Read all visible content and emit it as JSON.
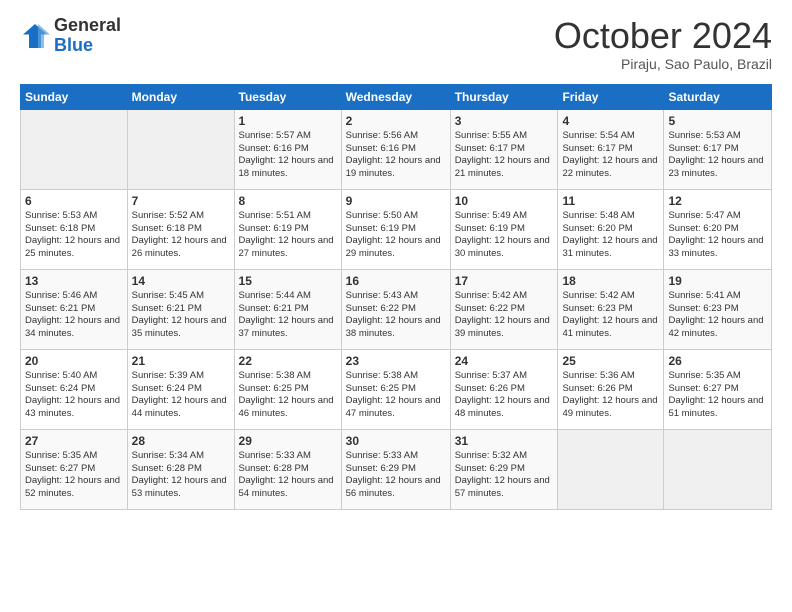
{
  "logo": {
    "general": "General",
    "blue": "Blue"
  },
  "title": "October 2024",
  "subtitle": "Piraju, Sao Paulo, Brazil",
  "weekdays": [
    "Sunday",
    "Monday",
    "Tuesday",
    "Wednesday",
    "Thursday",
    "Friday",
    "Saturday"
  ],
  "weeks": [
    [
      {
        "day": "",
        "empty": true
      },
      {
        "day": "",
        "empty": true
      },
      {
        "day": "1",
        "sunrise": "Sunrise: 5:57 AM",
        "sunset": "Sunset: 6:16 PM",
        "daylight": "Daylight: 12 hours and 18 minutes."
      },
      {
        "day": "2",
        "sunrise": "Sunrise: 5:56 AM",
        "sunset": "Sunset: 6:16 PM",
        "daylight": "Daylight: 12 hours and 19 minutes."
      },
      {
        "day": "3",
        "sunrise": "Sunrise: 5:55 AM",
        "sunset": "Sunset: 6:17 PM",
        "daylight": "Daylight: 12 hours and 21 minutes."
      },
      {
        "day": "4",
        "sunrise": "Sunrise: 5:54 AM",
        "sunset": "Sunset: 6:17 PM",
        "daylight": "Daylight: 12 hours and 22 minutes."
      },
      {
        "day": "5",
        "sunrise": "Sunrise: 5:53 AM",
        "sunset": "Sunset: 6:17 PM",
        "daylight": "Daylight: 12 hours and 23 minutes."
      }
    ],
    [
      {
        "day": "6",
        "sunrise": "Sunrise: 5:53 AM",
        "sunset": "Sunset: 6:18 PM",
        "daylight": "Daylight: 12 hours and 25 minutes."
      },
      {
        "day": "7",
        "sunrise": "Sunrise: 5:52 AM",
        "sunset": "Sunset: 6:18 PM",
        "daylight": "Daylight: 12 hours and 26 minutes."
      },
      {
        "day": "8",
        "sunrise": "Sunrise: 5:51 AM",
        "sunset": "Sunset: 6:19 PM",
        "daylight": "Daylight: 12 hours and 27 minutes."
      },
      {
        "day": "9",
        "sunrise": "Sunrise: 5:50 AM",
        "sunset": "Sunset: 6:19 PM",
        "daylight": "Daylight: 12 hours and 29 minutes."
      },
      {
        "day": "10",
        "sunrise": "Sunrise: 5:49 AM",
        "sunset": "Sunset: 6:19 PM",
        "daylight": "Daylight: 12 hours and 30 minutes."
      },
      {
        "day": "11",
        "sunrise": "Sunrise: 5:48 AM",
        "sunset": "Sunset: 6:20 PM",
        "daylight": "Daylight: 12 hours and 31 minutes."
      },
      {
        "day": "12",
        "sunrise": "Sunrise: 5:47 AM",
        "sunset": "Sunset: 6:20 PM",
        "daylight": "Daylight: 12 hours and 33 minutes."
      }
    ],
    [
      {
        "day": "13",
        "sunrise": "Sunrise: 5:46 AM",
        "sunset": "Sunset: 6:21 PM",
        "daylight": "Daylight: 12 hours and 34 minutes."
      },
      {
        "day": "14",
        "sunrise": "Sunrise: 5:45 AM",
        "sunset": "Sunset: 6:21 PM",
        "daylight": "Daylight: 12 hours and 35 minutes."
      },
      {
        "day": "15",
        "sunrise": "Sunrise: 5:44 AM",
        "sunset": "Sunset: 6:21 PM",
        "daylight": "Daylight: 12 hours and 37 minutes."
      },
      {
        "day": "16",
        "sunrise": "Sunrise: 5:43 AM",
        "sunset": "Sunset: 6:22 PM",
        "daylight": "Daylight: 12 hours and 38 minutes."
      },
      {
        "day": "17",
        "sunrise": "Sunrise: 5:42 AM",
        "sunset": "Sunset: 6:22 PM",
        "daylight": "Daylight: 12 hours and 39 minutes."
      },
      {
        "day": "18",
        "sunrise": "Sunrise: 5:42 AM",
        "sunset": "Sunset: 6:23 PM",
        "daylight": "Daylight: 12 hours and 41 minutes."
      },
      {
        "day": "19",
        "sunrise": "Sunrise: 5:41 AM",
        "sunset": "Sunset: 6:23 PM",
        "daylight": "Daylight: 12 hours and 42 minutes."
      }
    ],
    [
      {
        "day": "20",
        "sunrise": "Sunrise: 5:40 AM",
        "sunset": "Sunset: 6:24 PM",
        "daylight": "Daylight: 12 hours and 43 minutes."
      },
      {
        "day": "21",
        "sunrise": "Sunrise: 5:39 AM",
        "sunset": "Sunset: 6:24 PM",
        "daylight": "Daylight: 12 hours and 44 minutes."
      },
      {
        "day": "22",
        "sunrise": "Sunrise: 5:38 AM",
        "sunset": "Sunset: 6:25 PM",
        "daylight": "Daylight: 12 hours and 46 minutes."
      },
      {
        "day": "23",
        "sunrise": "Sunrise: 5:38 AM",
        "sunset": "Sunset: 6:25 PM",
        "daylight": "Daylight: 12 hours and 47 minutes."
      },
      {
        "day": "24",
        "sunrise": "Sunrise: 5:37 AM",
        "sunset": "Sunset: 6:26 PM",
        "daylight": "Daylight: 12 hours and 48 minutes."
      },
      {
        "day": "25",
        "sunrise": "Sunrise: 5:36 AM",
        "sunset": "Sunset: 6:26 PM",
        "daylight": "Daylight: 12 hours and 49 minutes."
      },
      {
        "day": "26",
        "sunrise": "Sunrise: 5:35 AM",
        "sunset": "Sunset: 6:27 PM",
        "daylight": "Daylight: 12 hours and 51 minutes."
      }
    ],
    [
      {
        "day": "27",
        "sunrise": "Sunrise: 5:35 AM",
        "sunset": "Sunset: 6:27 PM",
        "daylight": "Daylight: 12 hours and 52 minutes."
      },
      {
        "day": "28",
        "sunrise": "Sunrise: 5:34 AM",
        "sunset": "Sunset: 6:28 PM",
        "daylight": "Daylight: 12 hours and 53 minutes."
      },
      {
        "day": "29",
        "sunrise": "Sunrise: 5:33 AM",
        "sunset": "Sunset: 6:28 PM",
        "daylight": "Daylight: 12 hours and 54 minutes."
      },
      {
        "day": "30",
        "sunrise": "Sunrise: 5:33 AM",
        "sunset": "Sunset: 6:29 PM",
        "daylight": "Daylight: 12 hours and 56 minutes."
      },
      {
        "day": "31",
        "sunrise": "Sunrise: 5:32 AM",
        "sunset": "Sunset: 6:29 PM",
        "daylight": "Daylight: 12 hours and 57 minutes."
      },
      {
        "day": "",
        "empty": true
      },
      {
        "day": "",
        "empty": true
      }
    ]
  ]
}
